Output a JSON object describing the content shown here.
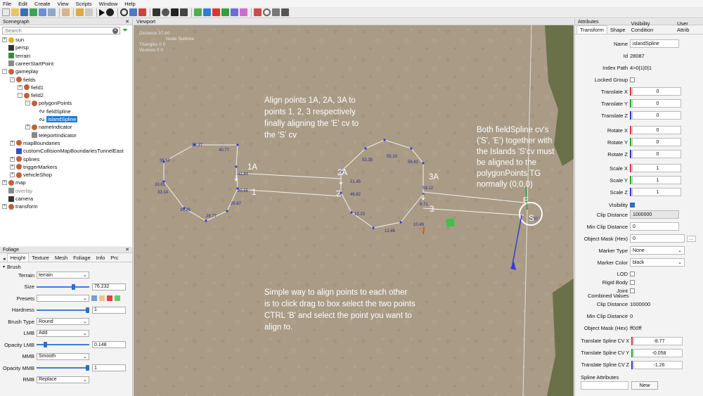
{
  "menu": [
    "File",
    "Edit",
    "Create",
    "View",
    "Scripts",
    "Window",
    "Help"
  ],
  "scenegraph": {
    "title": "Scenegraph",
    "search_placeholder": "Search",
    "items": [
      {
        "label": "sun",
        "indent": 0,
        "expander": "+",
        "icon": "sun"
      },
      {
        "label": "persp",
        "indent": 0,
        "expander": "",
        "icon": "camera"
      },
      {
        "label": "terrain",
        "indent": 0,
        "expander": "",
        "icon": "terrain"
      },
      {
        "label": "careerStartPoint",
        "indent": 0,
        "expander": "",
        "icon": "node"
      },
      {
        "label": "gameplay",
        "indent": 0,
        "expander": "-",
        "icon": "group"
      },
      {
        "label": "fields",
        "indent": 1,
        "expander": "-",
        "icon": "group"
      },
      {
        "label": "field1",
        "indent": 2,
        "expander": "+",
        "icon": "group"
      },
      {
        "label": "field2",
        "indent": 2,
        "expander": "-",
        "icon": "group"
      },
      {
        "label": "polygonPoints",
        "indent": 3,
        "expander": "-",
        "icon": "group"
      },
      {
        "label": "fieldSpline",
        "indent": 4,
        "expander": "",
        "icon": "spline"
      },
      {
        "label": "islandSpline",
        "indent": 4,
        "expander": "",
        "icon": "spline",
        "selected": true
      },
      {
        "label": "nameIndicator",
        "indent": 3,
        "expander": "+",
        "icon": "group"
      },
      {
        "label": "teleportIndicator",
        "indent": 3,
        "expander": "",
        "icon": "node"
      },
      {
        "label": "mapBoundaries",
        "indent": 1,
        "expander": "+",
        "icon": "group"
      },
      {
        "label": "customCollisionMapBoundariesTunnelEast",
        "indent": 1,
        "expander": "",
        "icon": "cube"
      },
      {
        "label": "splines",
        "indent": 1,
        "expander": "+",
        "icon": "group"
      },
      {
        "label": "triggerMarkers",
        "indent": 1,
        "expander": "+",
        "icon": "group"
      },
      {
        "label": "vehicleShop",
        "indent": 1,
        "expander": "+",
        "icon": "group"
      },
      {
        "label": "map",
        "indent": 0,
        "expander": "+",
        "icon": "group"
      },
      {
        "label": "overlay",
        "indent": 0,
        "expander": "",
        "icon": "node",
        "muted": true
      },
      {
        "label": "camera",
        "indent": 0,
        "expander": "",
        "icon": "camera"
      },
      {
        "label": "transform",
        "indent": 0,
        "expander": "+",
        "icon": "group"
      }
    ]
  },
  "foliage": {
    "title": "Foliage",
    "tabs": [
      "Height",
      "Texture",
      "Mesh",
      "Foliage",
      "Info",
      "Prc"
    ],
    "section": "Brush",
    "rows": [
      {
        "label": "Terrain",
        "select": "terrain"
      },
      {
        "label": "Size",
        "slider": 0.72,
        "value": "76.232"
      },
      {
        "label": "Presets",
        "select": ""
      },
      {
        "label": "Hardness",
        "slider": 1.0,
        "value": "1"
      },
      {
        "label": "Brush Type",
        "select": "Round"
      },
      {
        "label": "LMB",
        "select": "Add"
      },
      {
        "label": "Opacity LMB",
        "slider": 0.148,
        "value": "0.148"
      },
      {
        "label": "MMB",
        "select": "Smooth"
      },
      {
        "label": "Opacity MMB",
        "slider": 1.0,
        "value": "1"
      },
      {
        "label": "RMB",
        "select": "Replace"
      }
    ]
  },
  "viewport": {
    "title": "Viewport",
    "stats": {
      "distance": "Distance 37.80",
      "header": "Node  Subtree",
      "triangles": "Triangles   0       0",
      "vertices": "Vertices    0       0"
    },
    "note_top": [
      "Align points 1A, 2A, 3A to",
      "points 1, 2, 3 respectively",
      "finally aligning the 'E' cv to",
      "the 'S' cv"
    ],
    "note_right": [
      "Both fieldSpline cv's",
      "('S', 'E') together with",
      "the Islands 'S'cv must",
      "be aligned to the",
      "polygonPoints TG",
      "normally  (0,0,0)"
    ],
    "note_bottom": [
      "Simple way to align points to each other",
      "is to click drag to box select the two points",
      "CTRL 'B' and select the point you want to",
      "align to."
    ],
    "point_labels": [
      "38.37",
      "40.77",
      "35.60",
      "33.81",
      "33.14",
      "30.96",
      "28.77",
      "26.67",
      "25.55",
      "42.84",
      "51.45",
      "46.82",
      "53.35",
      "55.10",
      "56.82",
      "59.12",
      "15.23",
      "12.46",
      "10.49",
      "6.71",
      "0.00"
    ],
    "callouts": [
      "1A",
      "1",
      "2A",
      "2",
      "3A",
      "3",
      "E",
      "S"
    ]
  },
  "attributes": {
    "title": "Attributes",
    "tabs": [
      "Transform",
      "Shape",
      "Visibility Condition",
      "User Attrib"
    ],
    "name_label": "Name",
    "name": "islandSpline",
    "id_label": "Id",
    "id": "28087",
    "path_label": "Index Path",
    "path": "4>0|1|0|1",
    "locked_label": "Locked Group",
    "tx_label": "Translate X",
    "tx": "0",
    "ty_label": "Translate Y",
    "ty": "0",
    "tz_label": "Translate Z",
    "tz": "0",
    "rx_label": "Rotate X",
    "rx": "0",
    "ry_label": "Rotate Y",
    "ry": "0",
    "rz_label": "Rotate Z",
    "rz": "0",
    "sx_label": "Scale X",
    "sx": "1",
    "sy_label": "Scale Y",
    "sy": "1",
    "sz_label": "Scale Z",
    "sz": "1",
    "vis_label": "Visibility",
    "clip_label": "Clip Distance",
    "clip": "1000000",
    "minclip_label": "Min Clip Distance",
    "minclip": "0",
    "mask_label": "Object Mask (Hex)",
    "mask": "0",
    "mtype_label": "Marker Type",
    "mtype": "None",
    "mcolor_label": "Marker Color",
    "mcolor": "black",
    "lod_label": "LOD",
    "rigid_label": "Rigid Body",
    "joint_label": "Joint",
    "combined_label": "Combined Values",
    "c_clip_label": "Clip Distance",
    "c_clip": "1000000",
    "c_minclip_label": "Min Clip Distance",
    "c_minclip": "0",
    "c_mask_label": "Object Mask (Hex)",
    "c_mask": "ff00ff",
    "cvx_label": "Translate Spline CV X",
    "cvx": "-8.77",
    "cvy_label": "Translate Spline CV Y",
    "cvy": "-0.058",
    "cvz_label": "Translate Spline CV Z",
    "cvz": "-1.26",
    "spline_attr_label": "Spline Attributes",
    "new_button": "New"
  }
}
